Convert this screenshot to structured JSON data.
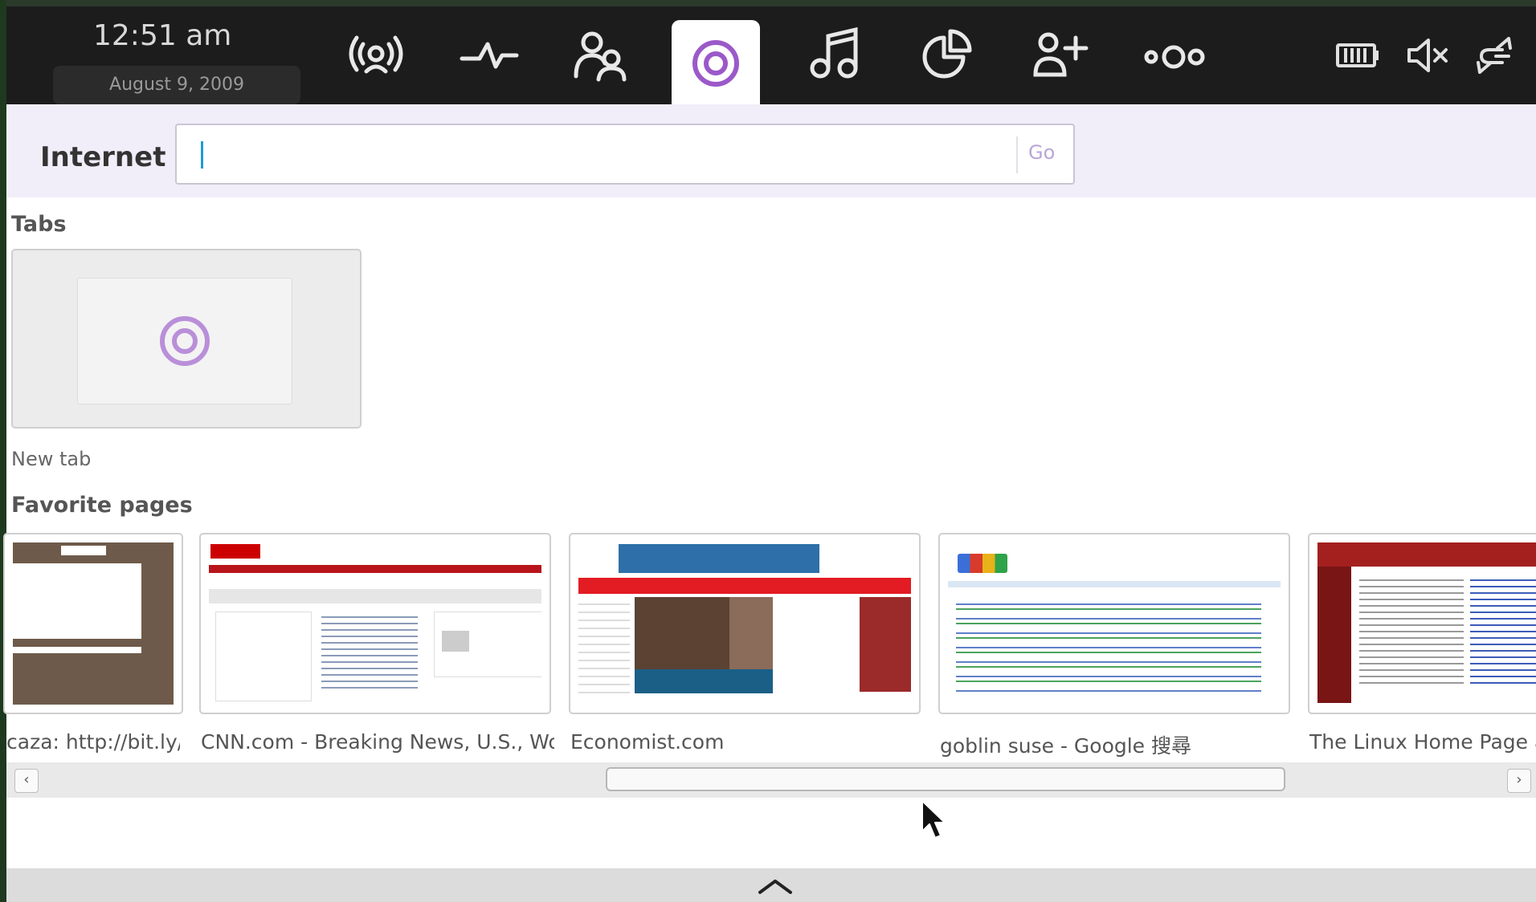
{
  "clock": {
    "time": "12:51 am",
    "date": "August 9, 2009"
  },
  "nav": [
    {
      "icon": "wireless-status-icon",
      "active": false
    },
    {
      "icon": "activity-pulse-icon",
      "active": false
    },
    {
      "icon": "people-icon",
      "active": false
    },
    {
      "icon": "internet-target-icon",
      "active": true
    },
    {
      "icon": "music-note-icon",
      "active": false
    },
    {
      "icon": "pie-chart-icon",
      "active": false
    },
    {
      "icon": "add-zone-icon",
      "active": false
    },
    {
      "icon": "more-apps-icon",
      "active": false
    }
  ],
  "system_icons": [
    "battery-icon",
    "volume-muted-icon",
    "network-icon"
  ],
  "search": {
    "label": "Internet",
    "placeholder": "",
    "value": "",
    "go_label": "Go"
  },
  "tabs": {
    "heading": "Tabs",
    "items": [
      {
        "label": "New tab"
      }
    ]
  },
  "favorites": {
    "heading": "Favorite pages",
    "items": [
      {
        "label": "caza: http://bit.ly/..."
      },
      {
        "label": "CNN.com - Breaking News, U.S., World..."
      },
      {
        "label": "Economist.com"
      },
      {
        "label": "goblin suse - Google 搜尋"
      },
      {
        "label": "The Linux Home Page at L"
      }
    ]
  },
  "scrollbar": {
    "left_arrow": "‹",
    "right_arrow": "›"
  },
  "colors": {
    "accent": "#9b59c9",
    "topbar": "#1c1c1c",
    "search_band": "#f1eef9"
  }
}
